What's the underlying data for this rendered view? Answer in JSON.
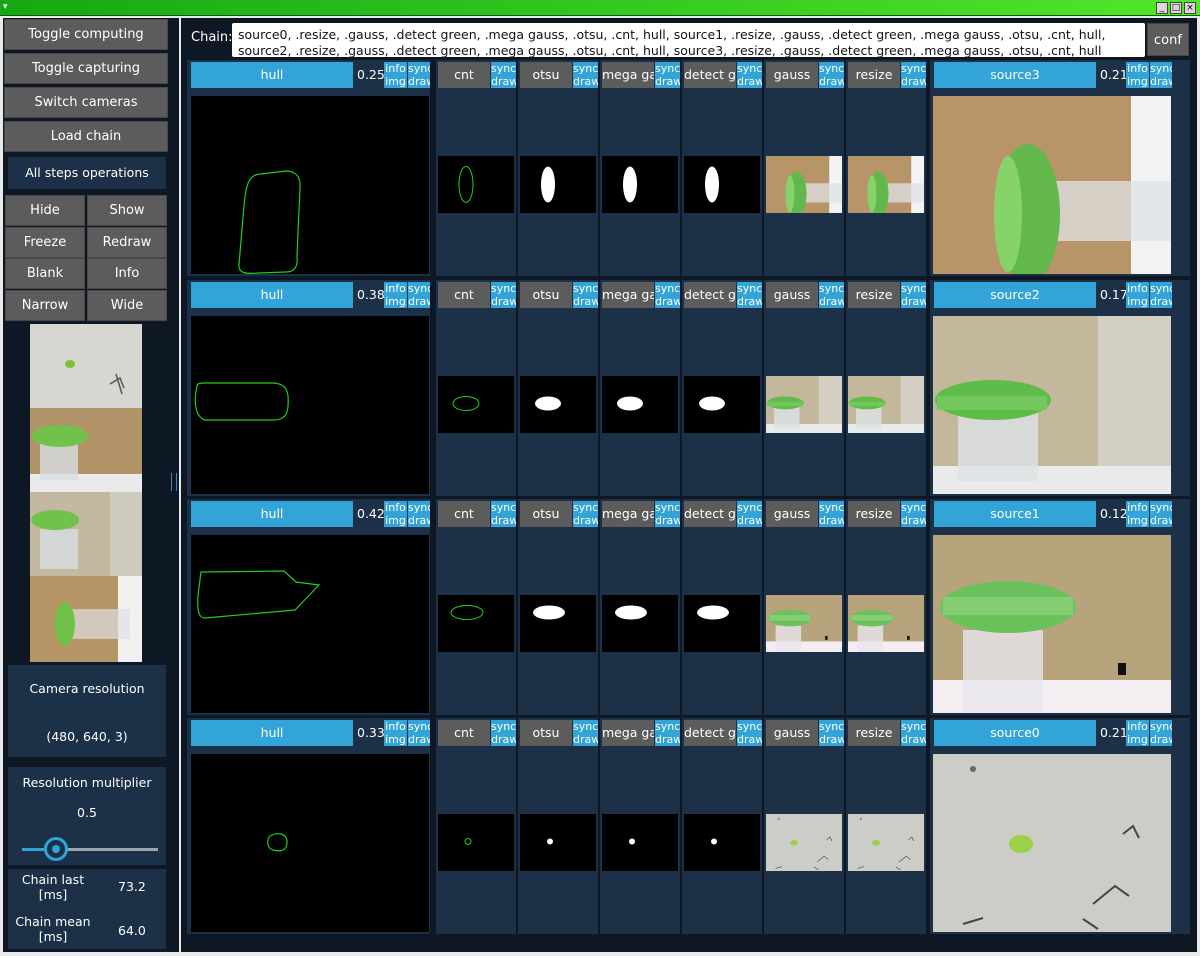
{
  "window": {
    "minimize": "_",
    "maximize": "□",
    "close": "×"
  },
  "sidebar": {
    "buttons": [
      "Toggle computing",
      "Toggle capturing",
      "Switch cameras",
      "Load chain"
    ],
    "all_steps_title": "All steps operations",
    "ops": [
      "Hide",
      "Show",
      "Freeze",
      "Redraw",
      "Blank",
      "Info",
      "Narrow",
      "Wide"
    ],
    "camera_resolution_label": "Camera resolution",
    "camera_resolution_value": "(480, 640, 3)",
    "multiplier_label": "Resolution multiplier",
    "multiplier_value": "0.5",
    "multiplier_fraction": 0.25,
    "chain_last_label": "Chain last [ms]",
    "chain_last_value": "73.2",
    "chain_mean_label": "Chain mean [ms]",
    "chain_mean_value": "64.0"
  },
  "chain": {
    "label": "Chain:",
    "value": "source0, .resize, .gauss, .detect green, .mega gauss, .otsu, .cnt, hull, source1, .resize, .gauss, .detect green, .mega gauss, .otsu, .cnt, hull, source2, .resize, .gauss, .detect green, .mega gauss, .otsu, .cnt, hull, source3, .resize, .gauss, .detect green, .mega gauss, .otsu, .cnt, hull",
    "conf_label": "conf"
  },
  "step_mini": {
    "info": "info",
    "sync": "sync",
    "img": "img",
    "draw": "draw"
  },
  "steps": [
    "cnt",
    "otsu",
    "mega gauss",
    "detect green",
    "gauss",
    "resize"
  ],
  "rows": [
    {
      "hull_name": "hull",
      "hull_score": "0.25",
      "source_name": "source3",
      "source_score": "0.21"
    },
    {
      "hull_name": "hull",
      "hull_score": "0.38",
      "source_name": "source2",
      "source_score": "0.17"
    },
    {
      "hull_name": "hull",
      "hull_score": "0.42",
      "source_name": "source1",
      "source_score": "0.12"
    },
    {
      "hull_name": "hull",
      "hull_score": "0.33",
      "source_name": "source0",
      "source_score": "0.21"
    }
  ],
  "colors": {
    "accent": "#33a4d8",
    "panel": "#1c3047",
    "background": "#0e1824",
    "button": "#5c5c5c",
    "contour": "#1fd01a",
    "titlebar": "#16a814"
  }
}
